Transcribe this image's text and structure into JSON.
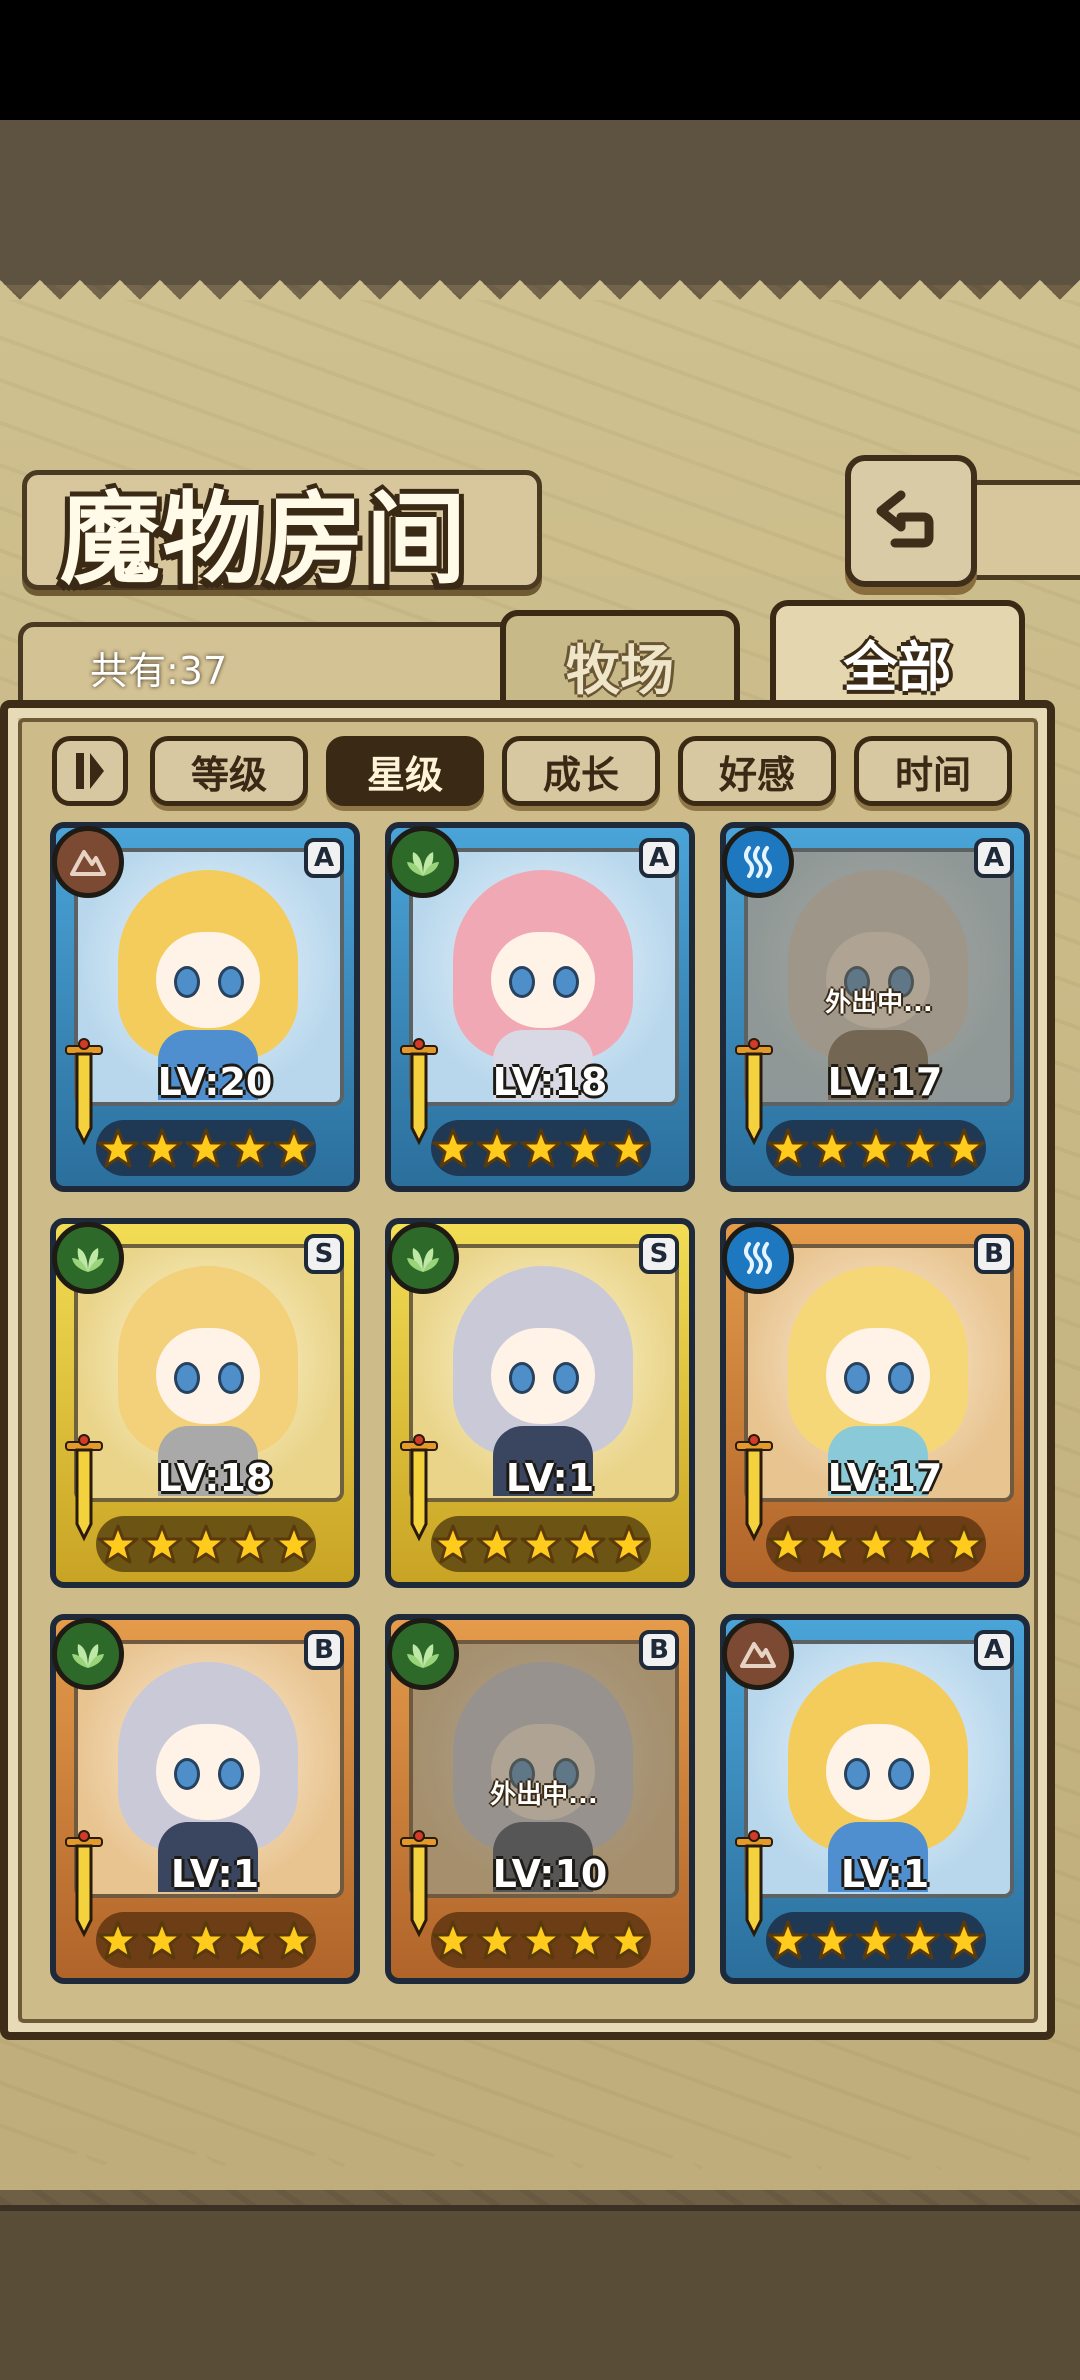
{
  "title": "魔物房间",
  "count_text": "共有:37",
  "tabs": [
    {
      "label": "牧场",
      "active": false
    },
    {
      "label": "全部",
      "active": true
    }
  ],
  "sort": {
    "options": [
      "等级",
      "星级",
      "成长",
      "好感",
      "时间"
    ],
    "selected": "星级"
  },
  "monsters": [
    {
      "element": "earth-icon",
      "rank": "A",
      "frame": "blue",
      "level": "LV:20",
      "stars": 5,
      "status": "",
      "hair": "#f3cc5c",
      "outfit": "#4f8fd0"
    },
    {
      "element": "leaf-icon",
      "rank": "A",
      "frame": "blue",
      "level": "LV:18",
      "stars": 5,
      "status": "",
      "hair": "#f0a8b4",
      "outfit": "#d9d9e6"
    },
    {
      "element": "water-icon",
      "rank": "A",
      "frame": "blue",
      "level": "LV:17",
      "stars": 5,
      "status": "外出中...",
      "hair": "#d8d2cf",
      "outfit": "#7a6a5a"
    },
    {
      "element": "leaf-icon",
      "rank": "S",
      "frame": "gold",
      "level": "LV:18",
      "stars": 5,
      "status": "",
      "hair": "#f3d07a",
      "outfit": "#a9a9a9"
    },
    {
      "element": "leaf-icon",
      "rank": "S",
      "frame": "gold",
      "level": "LV:1",
      "stars": 5,
      "status": "",
      "hair": "#c9c9d8",
      "outfit": "#3a4560"
    },
    {
      "element": "water-icon",
      "rank": "B",
      "frame": "bronze",
      "level": "LV:17",
      "stars": 5,
      "status": "",
      "hair": "#f6d777",
      "outfit": "#8ac9d8"
    },
    {
      "element": "leaf-icon",
      "rank": "B",
      "frame": "bronze",
      "level": "LV:1",
      "stars": 5,
      "status": "",
      "hair": "#c9c9d8",
      "outfit": "#3a4560"
    },
    {
      "element": "leaf-icon",
      "rank": "B",
      "frame": "bronze",
      "level": "LV:10",
      "stars": 5,
      "status": "外出中...",
      "hair": "#c9c9d8",
      "outfit": "#3a4560"
    },
    {
      "element": "earth-icon",
      "rank": "A",
      "frame": "blue",
      "level": "LV:1",
      "stars": 5,
      "status": "",
      "hair": "#f3cc5c",
      "outfit": "#4f8fd0"
    }
  ]
}
